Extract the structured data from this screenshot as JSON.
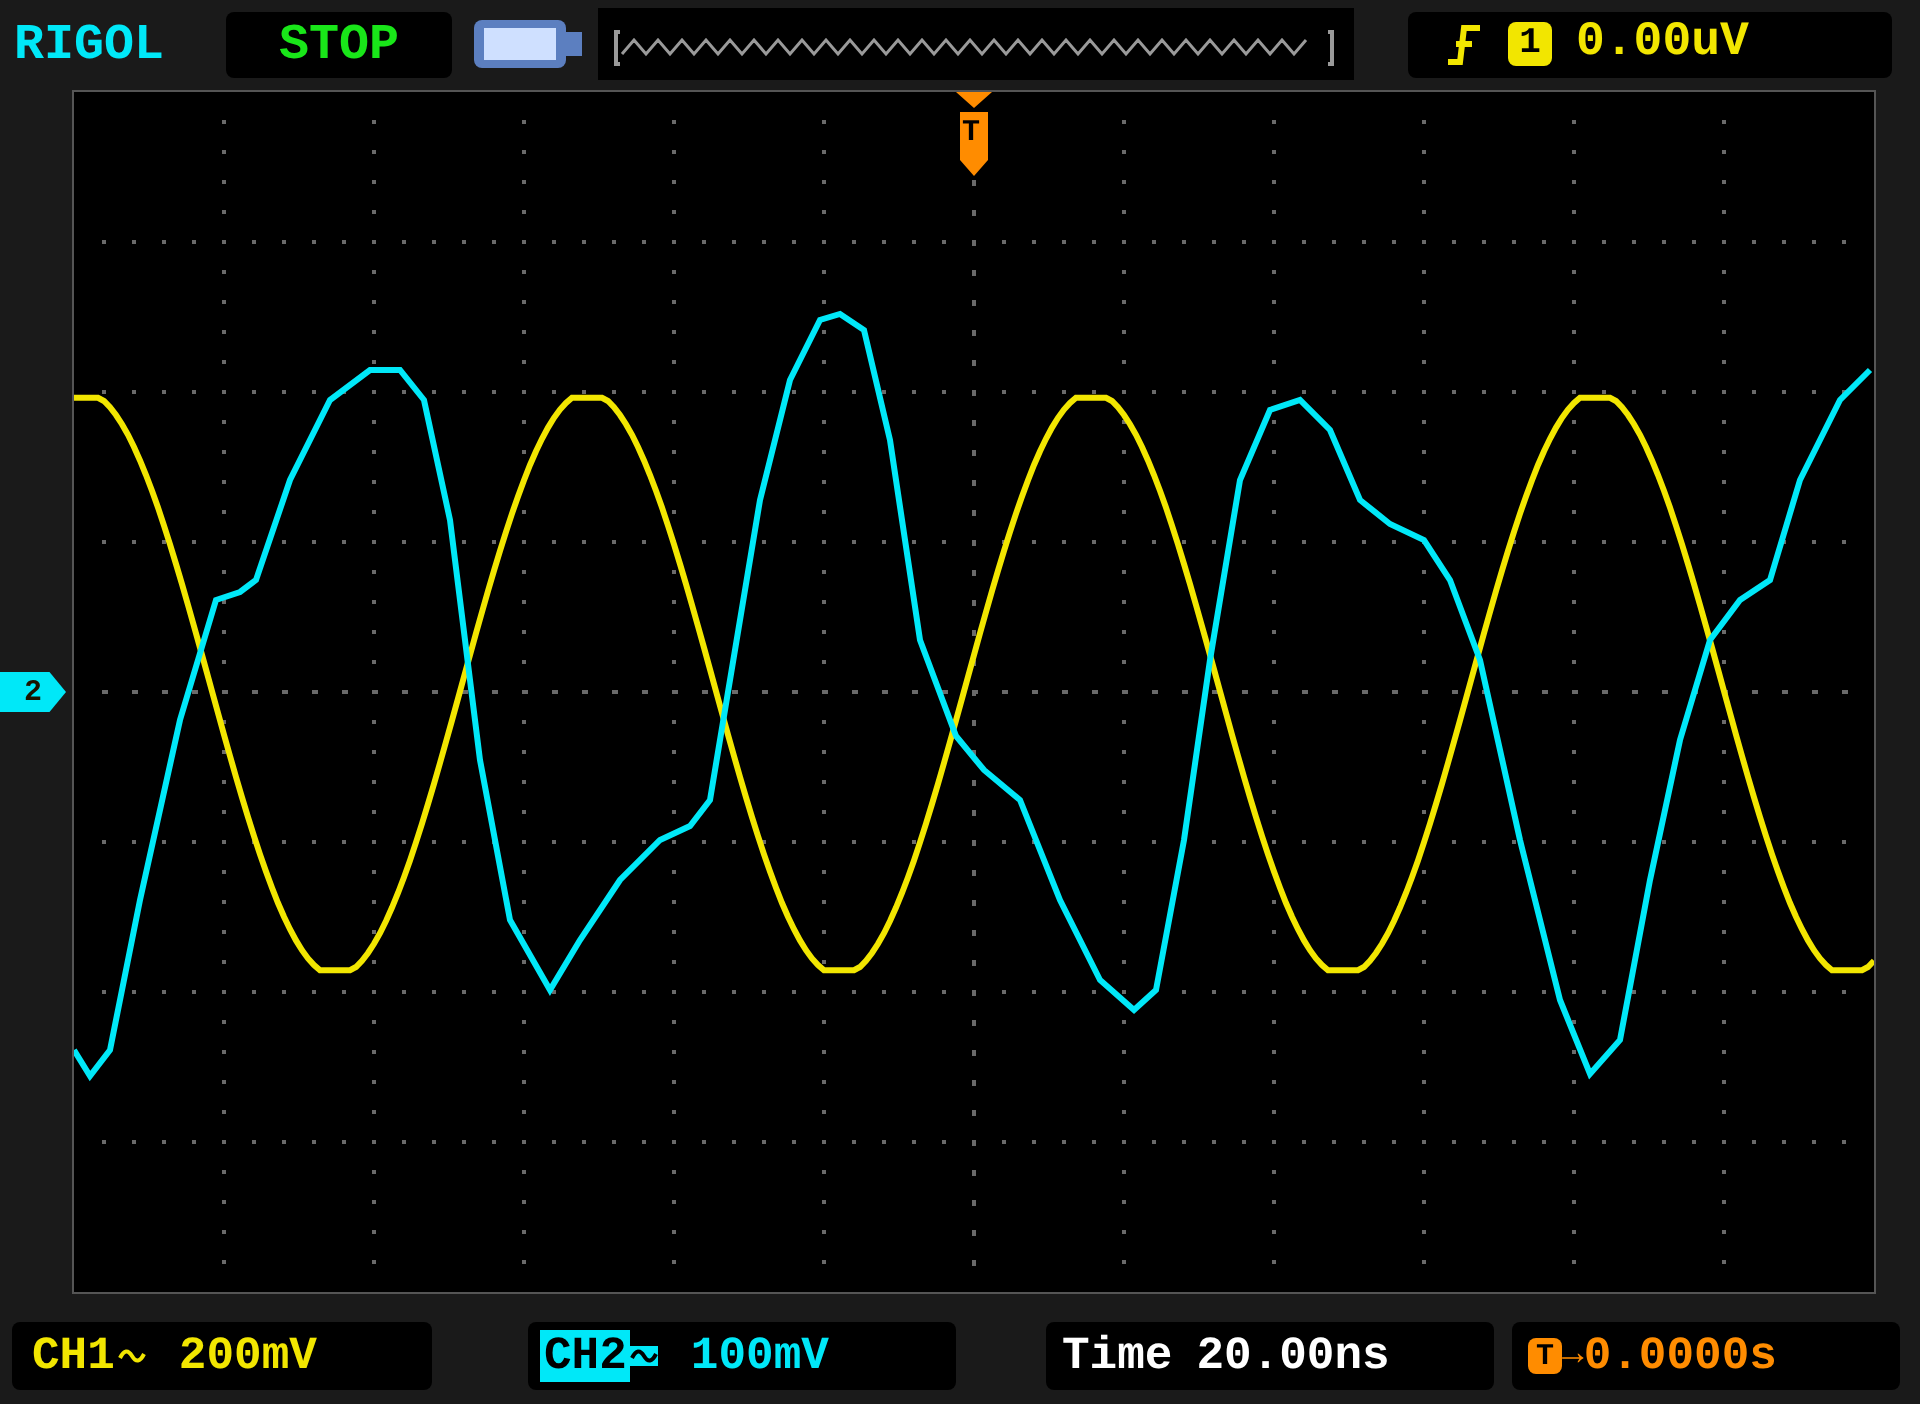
{
  "brand": "RIGOL",
  "run_state": "STOP",
  "trigger": {
    "source": "1",
    "level": "0.00uV"
  },
  "trigger_marker": "T",
  "channels": [
    {
      "label": "CH1",
      "scale": "200mV",
      "selected": false,
      "color": "#f2e600"
    },
    {
      "label": "CH2",
      "scale": "100mV",
      "selected": true,
      "color": "#00e8f8"
    }
  ],
  "channel_marker": "2",
  "timebase": {
    "label": "Time",
    "value": "20.00ns"
  },
  "trigger_offset": {
    "marker": "T",
    "arrow": "→",
    "value": "0.0000s"
  }
}
